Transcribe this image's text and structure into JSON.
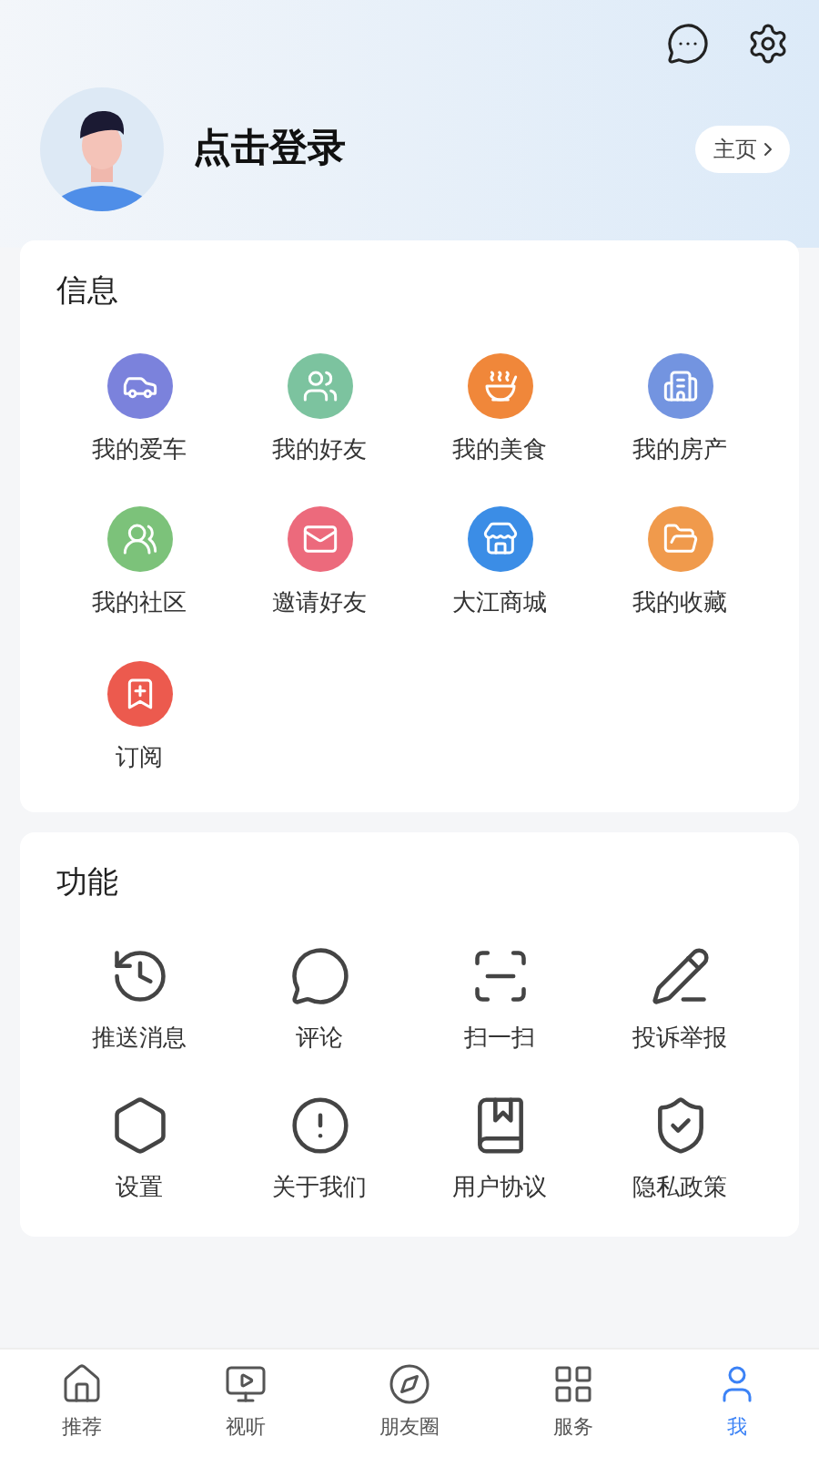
{
  "header": {
    "login_text": "点击登录",
    "home_button": "主页"
  },
  "info": {
    "title": "信息",
    "items": [
      {
        "label": "我的爱车",
        "color": "#7b82dc"
      },
      {
        "label": "我的好友",
        "color": "#7cc39f"
      },
      {
        "label": "我的美食",
        "color": "#f0873a"
      },
      {
        "label": "我的房产",
        "color": "#7394e0"
      },
      {
        "label": "我的社区",
        "color": "#7cc27a"
      },
      {
        "label": "邀请好友",
        "color": "#ec6a7c"
      },
      {
        "label": "大江商城",
        "color": "#3b8de6"
      },
      {
        "label": "我的收藏",
        "color": "#f09a4c"
      },
      {
        "label": "订阅",
        "color": "#ec5a4e"
      }
    ]
  },
  "functions": {
    "title": "功能",
    "items": [
      {
        "label": "推送消息"
      },
      {
        "label": "评论"
      },
      {
        "label": "扫一扫"
      },
      {
        "label": "投诉举报"
      },
      {
        "label": "设置"
      },
      {
        "label": "关于我们"
      },
      {
        "label": "用户协议"
      },
      {
        "label": "隐私政策"
      }
    ]
  },
  "tab_bar": [
    {
      "label": "推荐",
      "selected": false
    },
    {
      "label": "视听",
      "selected": false
    },
    {
      "label": "朋友圈",
      "selected": false
    },
    {
      "label": "服务",
      "selected": false
    },
    {
      "label": "我",
      "selected": true
    }
  ]
}
